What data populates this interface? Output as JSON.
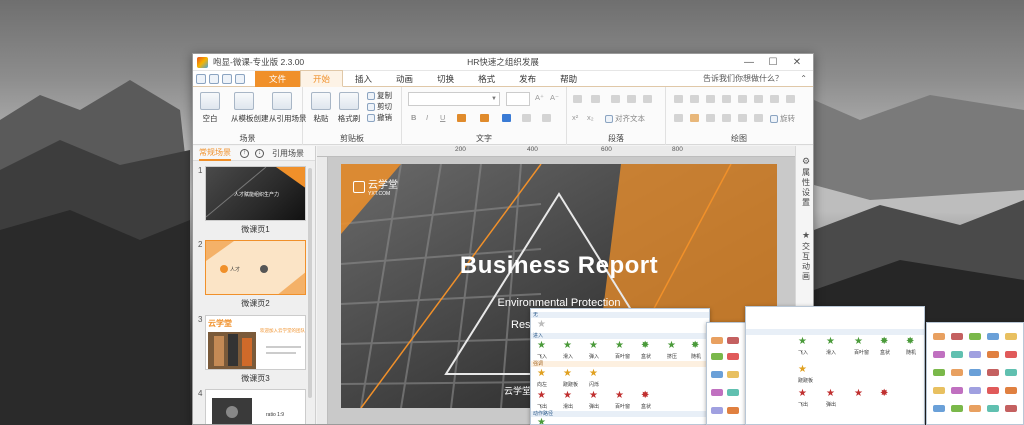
{
  "window": {
    "app_title": "咆显-微课-专业版 2.3.00",
    "doc_title": "HR快速之组织发展",
    "controls": [
      "—",
      "☐",
      "✕"
    ]
  },
  "tabs": [
    {
      "label": "文件"
    },
    {
      "label": "开始"
    },
    {
      "label": "插入"
    },
    {
      "label": "动画"
    },
    {
      "label": "切换"
    },
    {
      "label": "格式"
    },
    {
      "label": "发布"
    },
    {
      "label": "帮助"
    }
  ],
  "help_text": "告诉我们你想做什么？",
  "ribbon": {
    "scene_group": {
      "label": "场景",
      "buttons": [
        "空白",
        "从模板创建",
        "从引用场景"
      ]
    },
    "clipboard_group": {
      "label": "剪贴板",
      "buttons": [
        "粘贴",
        "格式刷"
      ],
      "small": [
        "复制",
        "剪切",
        "撤销"
      ]
    },
    "text_group": {
      "label": "文字"
    },
    "paragraph_group": {
      "label": "段落",
      "align_text": "对齐文本"
    },
    "drawing_group": {
      "label": "绘图",
      "rotate": "旋转"
    }
  },
  "left_pane": {
    "tab": "常规场景",
    "ref": "引用场景",
    "up": "↑",
    "down": "↓",
    "slides": [
      {
        "num": "1",
        "caption": "微课页1",
        "thumb_text": "人才赋能组织生产力"
      },
      {
        "num": "2",
        "caption": "微课页2",
        "thumb_text": "人才"
      },
      {
        "num": "3",
        "caption": "微课页3",
        "thumb_brand": "云学堂",
        "thumb_text": "欢迎加入云学堂的团队"
      },
      {
        "num": "4",
        "caption": "",
        "thumb_text": "ratio 1:9"
      }
    ]
  },
  "ruler": {
    "marks": [
      "200",
      "400",
      "600",
      "800"
    ]
  },
  "slide": {
    "brand": "云学堂",
    "brand_url": "YXT.COM",
    "title": "Business Report",
    "subtitle": "Environmental Protection",
    "subtitle2": "Res",
    "footer": "云学堂",
    "accent": "#f0902a"
  },
  "right_pane": [
    {
      "icon": "gear-icon",
      "label": "属性设置"
    },
    {
      "icon": "star-icon",
      "label": "交互动画"
    }
  ],
  "overlay_panels": [
    {
      "rows": [
        "无",
        "进入",
        "强调",
        "动作路径"
      ],
      "labels_a": [
        "飞入",
        "滑入",
        "弹入",
        "百叶窗",
        "盒状",
        "挤压",
        "随机"
      ],
      "labels_b": [
        "向左",
        "跷跷板",
        "闪烁"
      ],
      "labels_c": [
        "飞出",
        "滑出",
        "弹出",
        "百叶窗",
        "盒状"
      ]
    },
    {
      "labels": [
        "飞入",
        "滑入",
        "百叶窗",
        "盒状",
        "随机",
        "跷跷板",
        "飞出",
        "弹出"
      ]
    }
  ],
  "colors": {
    "accent": "#f0902a",
    "window_bg": "#f3f3f3",
    "ribbon_bg": "#fbfbfb"
  }
}
